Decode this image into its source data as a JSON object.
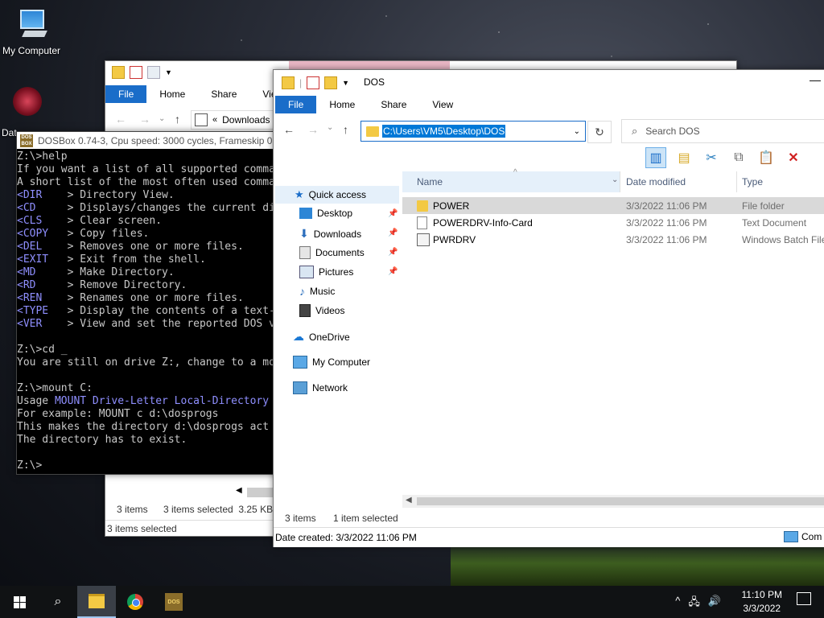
{
  "desktop": {
    "my_computer_label": "My Computer",
    "dat_label": "Dat"
  },
  "back_explorer": {
    "tabs": [
      "File",
      "Home",
      "Share",
      "View"
    ],
    "address": "Downloads",
    "status_items": "3 items",
    "status_selected": "3 items selected  3.25 KB",
    "detail": "3 items selected"
  },
  "dosbox": {
    "title": "DOSBox 0.74-3, Cpu speed:     3000 cycles, Frameskip  0,",
    "lines": [
      {
        "t": "Z:\\>help",
        "c": ""
      },
      {
        "t": "If you want a list of all supported commands",
        "c": ""
      },
      {
        "t": "A short list of the most often used commands",
        "c": ""
      },
      {
        "k": "<DIR  ",
        "t": "  > Directory View.",
        "c": "cmd"
      },
      {
        "k": "<CD   ",
        "t": "  > Displays/changes the current directory",
        "c": "cmd"
      },
      {
        "k": "<CLS  ",
        "t": "  > Clear screen.",
        "c": "cmd"
      },
      {
        "k": "<COPY ",
        "t": "  > Copy files.",
        "c": "cmd"
      },
      {
        "k": "<DEL  ",
        "t": "  > Removes one or more files.",
        "c": "cmd"
      },
      {
        "k": "<EXIT ",
        "t": "  > Exit from the shell.",
        "c": "cmd"
      },
      {
        "k": "<MD   ",
        "t": "  > Make Directory.",
        "c": "cmd"
      },
      {
        "k": "<RD   ",
        "t": "  > Remove Directory.",
        "c": "cmd"
      },
      {
        "k": "<REN  ",
        "t": "  > Renames one or more files.",
        "c": "cmd"
      },
      {
        "k": "<TYPE ",
        "t": "  > Display the contents of a text-file.",
        "c": "cmd"
      },
      {
        "k": "<VER  ",
        "t": "  > View and set the reported DOS version.",
        "c": "cmd"
      },
      {
        "t": "",
        "c": ""
      },
      {
        "t": "Z:\\>cd _",
        "c": ""
      },
      {
        "t": "You are still on drive Z:, change to a mounted drive",
        "c": ""
      },
      {
        "t": "",
        "c": ""
      },
      {
        "t": "Z:\\>mount C:",
        "c": ""
      },
      {
        "t": "Usage ",
        "k2": "MOUNT Drive-Letter Local-Directory",
        "c": "usage"
      },
      {
        "t": "For example: MOUNT c d:\\dosprogs",
        "c": ""
      },
      {
        "t": "This makes the directory d:\\dosprogs act as the C: drive",
        "c": ""
      },
      {
        "t": "The directory has to exist.",
        "c": ""
      },
      {
        "t": "",
        "c": ""
      },
      {
        "t": "Z:\\>",
        "c": ""
      }
    ]
  },
  "front_explorer": {
    "title": "DOS",
    "tabs": [
      "File",
      "Home",
      "Share",
      "View"
    ],
    "address_path": "C:\\Users\\VM5\\Desktop\\DOS",
    "search_placeholder": "Search DOS",
    "nav": {
      "quick_access": "Quick access",
      "desktop": "Desktop",
      "downloads": "Downloads",
      "documents": "Documents",
      "pictures": "Pictures",
      "music": "Music",
      "videos": "Videos",
      "onedrive": "OneDrive",
      "my_computer": "My Computer",
      "network": "Network"
    },
    "columns": {
      "name": "Name",
      "date": "Date modified",
      "type": "Type"
    },
    "files": [
      {
        "name": "POWER",
        "date": "3/3/2022 11:06 PM",
        "type": "File folder",
        "icon": "folder-icon",
        "selected": true
      },
      {
        "name": "POWERDRV-Info-Card",
        "date": "3/3/2022 11:06 PM",
        "type": "Text Document",
        "icon": "text-file-icon",
        "selected": false
      },
      {
        "name": "PWRDRV",
        "date": "3/3/2022 11:06 PM",
        "type": "Windows Batch File",
        "icon": "batch-file-icon",
        "selected": false
      }
    ],
    "status_items": "3 items",
    "status_selected": "1 item selected",
    "detail": "Date created: 3/3/2022 11:06 PM",
    "detail_right": "Com"
  },
  "taskbar": {
    "time": "11:10 PM",
    "date": "3/3/2022"
  },
  "colors": {
    "accent": "#1a6dc9",
    "selection": "#0078d7"
  }
}
